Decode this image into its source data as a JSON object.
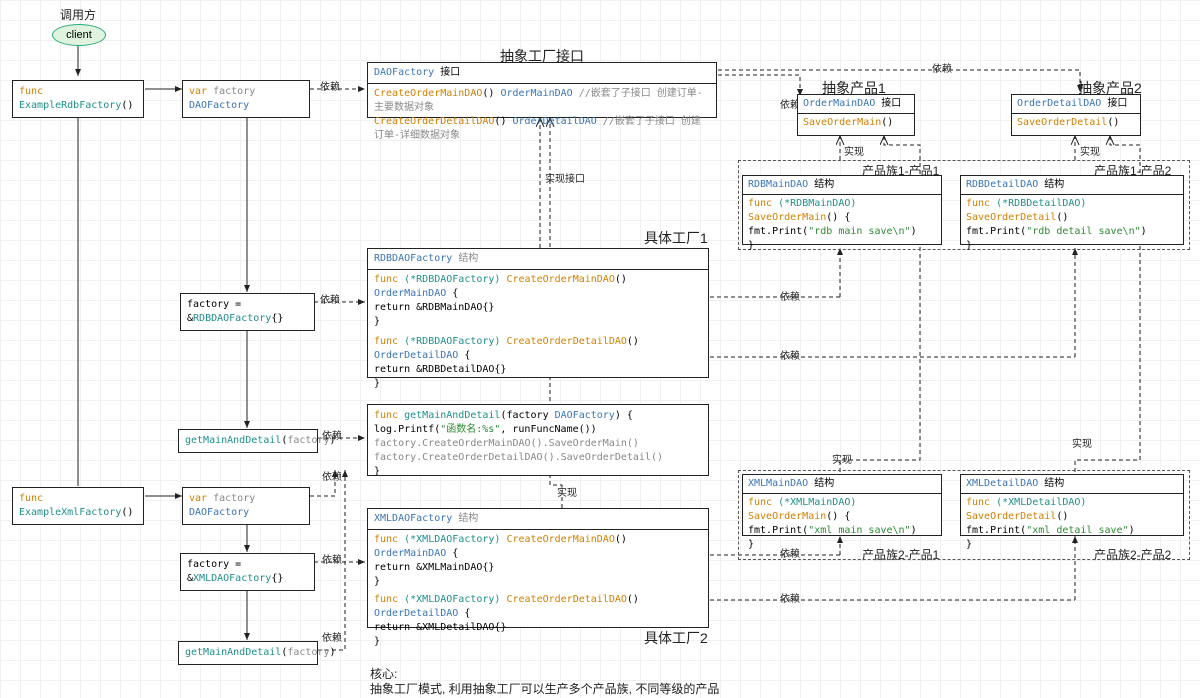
{
  "labels": {
    "caller": "调用方",
    "client": "client",
    "abstractFactoryIf": "抽象工厂接口",
    "abstractProd1": "抽象产品1",
    "abstractProd2": "抽象产品2",
    "family1prod1": "产品族1-产品1",
    "family1prod2": "产品族1-产品2",
    "family2prod1": "产品族2-产品1",
    "family2prod2": "产品族2-产品2",
    "concreteFactory1": "具体工厂1",
    "concreteFactory2": "具体工厂2",
    "depend": "依赖",
    "implIf": "实现接口",
    "impl": "实现",
    "core1": "核心:",
    "core2": "抽象工厂模式, 利用抽象工厂可以生产多个产品族, 不同等级的产品"
  },
  "nodes": {
    "exRdb": {
      "func": "func",
      "name": "ExampleRdbFactory",
      "paren": "()"
    },
    "exXml": {
      "func": "func",
      "name": "ExampleXmlFactory",
      "paren": "()"
    },
    "varFactory1": {
      "var": "var",
      "name": "factory",
      "type": "DAOFactory"
    },
    "varFactory2": {
      "var": "var",
      "name": "factory",
      "type": "DAOFactory"
    },
    "assignRdb": {
      "lhs": "factory = &",
      "rhs": "RDBDAOFactory",
      "end": "{}"
    },
    "assignXml": {
      "lhs": "factory = &",
      "rhs": "XMLDAOFactory",
      "end": "{}"
    },
    "getMain1": {
      "name": "getMainAndDetail",
      "arg": "factory"
    },
    "getMain2": {
      "name": "getMainAndDetail",
      "arg": "factory"
    },
    "daoFactory": {
      "title1": "DAOFactory",
      "title2": "接口",
      "m1a": "CreateOrderMainDAO",
      "m1b": "() ",
      "m1c": "OrderMainDAO",
      "m1d": "  //嵌套了子接口  创建订单-主要数据对象",
      "m2a": "CreateOrderDetailDAO",
      "m2b": "() ",
      "m2c": "OrderDetailDAO",
      "m2d": " //嵌套了子接口  创建订单-详细数据对象"
    },
    "orderMainDAO": {
      "title1": "OrderMainDAO",
      "title2": "接口",
      "m": "SaveOrderMain",
      "paren": "()"
    },
    "orderDetailDAO": {
      "title1": "OrderDetailDAO",
      "title2": "接口",
      "m": "SaveOrderDetail",
      "paren": "()"
    },
    "rdbMainDAO": {
      "title1": "RDBMainDAO",
      "title2": "结构",
      "l1a": "func ",
      "l1b": "(*RDBMainDAO) ",
      "l1c": "SaveOrderMain",
      "l1d": "() {",
      "l2": "  fmt.Print(",
      "l2s": "\"rdb main save\\n\"",
      "l2e": ")",
      "l3": "}"
    },
    "rdbDetailDAO": {
      "title1": "RDBDetailDAO",
      "title2": "结构",
      "l1a": "func ",
      "l1b": "(*RDBDetailDAO) ",
      "l1c": "SaveOrderDetail",
      "l1d": "()",
      "l2": "  fmt.Print(",
      "l2s": "\"rdb detail save\\n\"",
      "l2e": ")",
      "l3": "}"
    },
    "xmlMainDAO": {
      "title1": "XMLMainDAO",
      "title2": "结构",
      "l1a": "func ",
      "l1b": "(*XMLMainDAO) ",
      "l1c": "SaveOrderMain",
      "l1d": "() {",
      "l2": "  fmt.Print(",
      "l2s": "\"xml main save\\n\"",
      "l2e": ")",
      "l3": "}"
    },
    "xmlDetailDAO": {
      "title1": "XMLDetailDAO",
      "title2": "结构",
      "l1a": "func ",
      "l1b": "(*XMLDetailDAO) ",
      "l1c": "SaveOrderDetail",
      "l1d": "()",
      "l2": "  fmt.Print(",
      "l2s": "\"xml detail save\"",
      "l2e": ")",
      "l3": "}"
    },
    "rdbFactory": {
      "title1": "RDBDAOFactory",
      "title2": "结构",
      "f1a": "func ",
      "f1b": "(*RDBDAOFactory) ",
      "f1c": "CreateOrderMainDAO",
      "f1d": "() ",
      "f1e": "OrderMainDAO",
      "f1f": " {",
      "f1r": "  return &RDBMainDAO{}",
      "f1c2": "}",
      "f2a": "func ",
      "f2b": "(*RDBDAOFactory) ",
      "f2c": "CreateOrderDetailDAO",
      "f2d": "() ",
      "f2e": "OrderDetailDAO",
      "f2f": " {",
      "f2r": "  return &RDBDetailDAO{}",
      "f2c2": "}"
    },
    "xmlFactory": {
      "title1": "XMLDAOFactory",
      "title2": "结构",
      "f1a": "func ",
      "f1b": "(*XMLDAOFactory) ",
      "f1c": "CreateOrderMainDAO",
      "f1d": "() ",
      "f1e": "OrderMainDAO",
      "f1f": " {",
      "f1r": "  return &XMLMainDAO{}",
      "f1c2": "}",
      "f2a": "func ",
      "f2b": "(*XMLDAOFactory) ",
      "f2c": "CreateOrderDetailDAO",
      "f2d": "() ",
      "f2e": "OrderDetailDAO",
      "f2f": " {",
      "f2r": "  return &XMLDetailDAO{}",
      "f2c2": "}"
    },
    "getMainDetailFn": {
      "l1a": "func ",
      "l1b": "getMainAndDetail",
      "l1c": "(factory ",
      "l1d": "DAOFactory",
      "l1e": ") {",
      "l2": "  log.Printf(",
      "l2s": "\"函数名:%s\"",
      "l2e": ", runFuncName())",
      "l3": "  factory.CreateOrderMainDAO().SaveOrderMain()",
      "l4": "  factory.CreateOrderDetailDAO().SaveOrderDetail()",
      "l5": "}"
    }
  }
}
